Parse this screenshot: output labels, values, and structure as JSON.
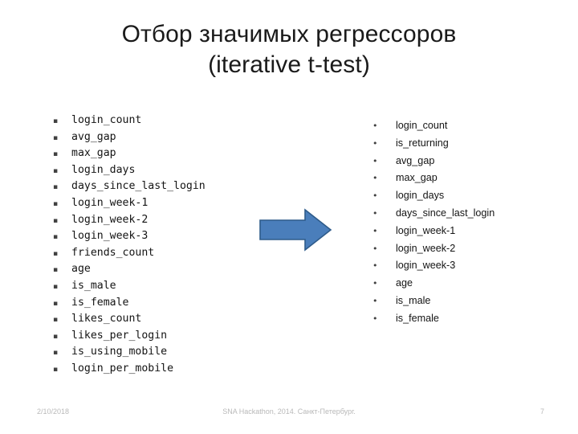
{
  "slide": {
    "title_line_1": "Отбор значимых регрессоров",
    "title_line_2": "(iterative t-test)",
    "background_color": "#ffffff",
    "title_color": "#1a1a1a"
  },
  "left_list": {
    "bullet_glyph": "▪",
    "items": [
      {
        "text": "login_count"
      },
      {
        "text": "avg_gap"
      },
      {
        "text": "max_gap"
      },
      {
        "text": "login_days"
      },
      {
        "text": "days_since_last_login"
      },
      {
        "text": "login_week-1"
      },
      {
        "text": "login_week-2"
      },
      {
        "text": "login_week-3"
      },
      {
        "text": "friends_count"
      },
      {
        "text": "age"
      },
      {
        "text": "is_male"
      },
      {
        "text": "is_female"
      },
      {
        "text": "likes_count"
      },
      {
        "text": "likes_per_login"
      },
      {
        "text": "is_using_mobile"
      },
      {
        "text": "login_per_mobile"
      }
    ]
  },
  "right_list": {
    "bullet_glyph": "•",
    "items": [
      {
        "text": "login_count"
      },
      {
        "text": "is_returning"
      },
      {
        "text": "avg_gap"
      },
      {
        "text": "max_gap"
      },
      {
        "text": "login_days"
      },
      {
        "text": "days_since_last_login"
      },
      {
        "text": "login_week-1"
      },
      {
        "text": "login_week-2"
      },
      {
        "text": "login_week-3"
      },
      {
        "text": "age"
      },
      {
        "text": "is_male"
      },
      {
        "text": "is_female"
      }
    ]
  },
  "arrow": {
    "direction": "right",
    "fill_color": "#4a7ebb",
    "stroke_color": "#2e5b8a"
  },
  "footer": {
    "date": "2/10/2018",
    "center_text": "SNA Hackathon, 2014. Санкт-Петербург.",
    "page_number": "7",
    "text_color": "#b9b9b9"
  }
}
